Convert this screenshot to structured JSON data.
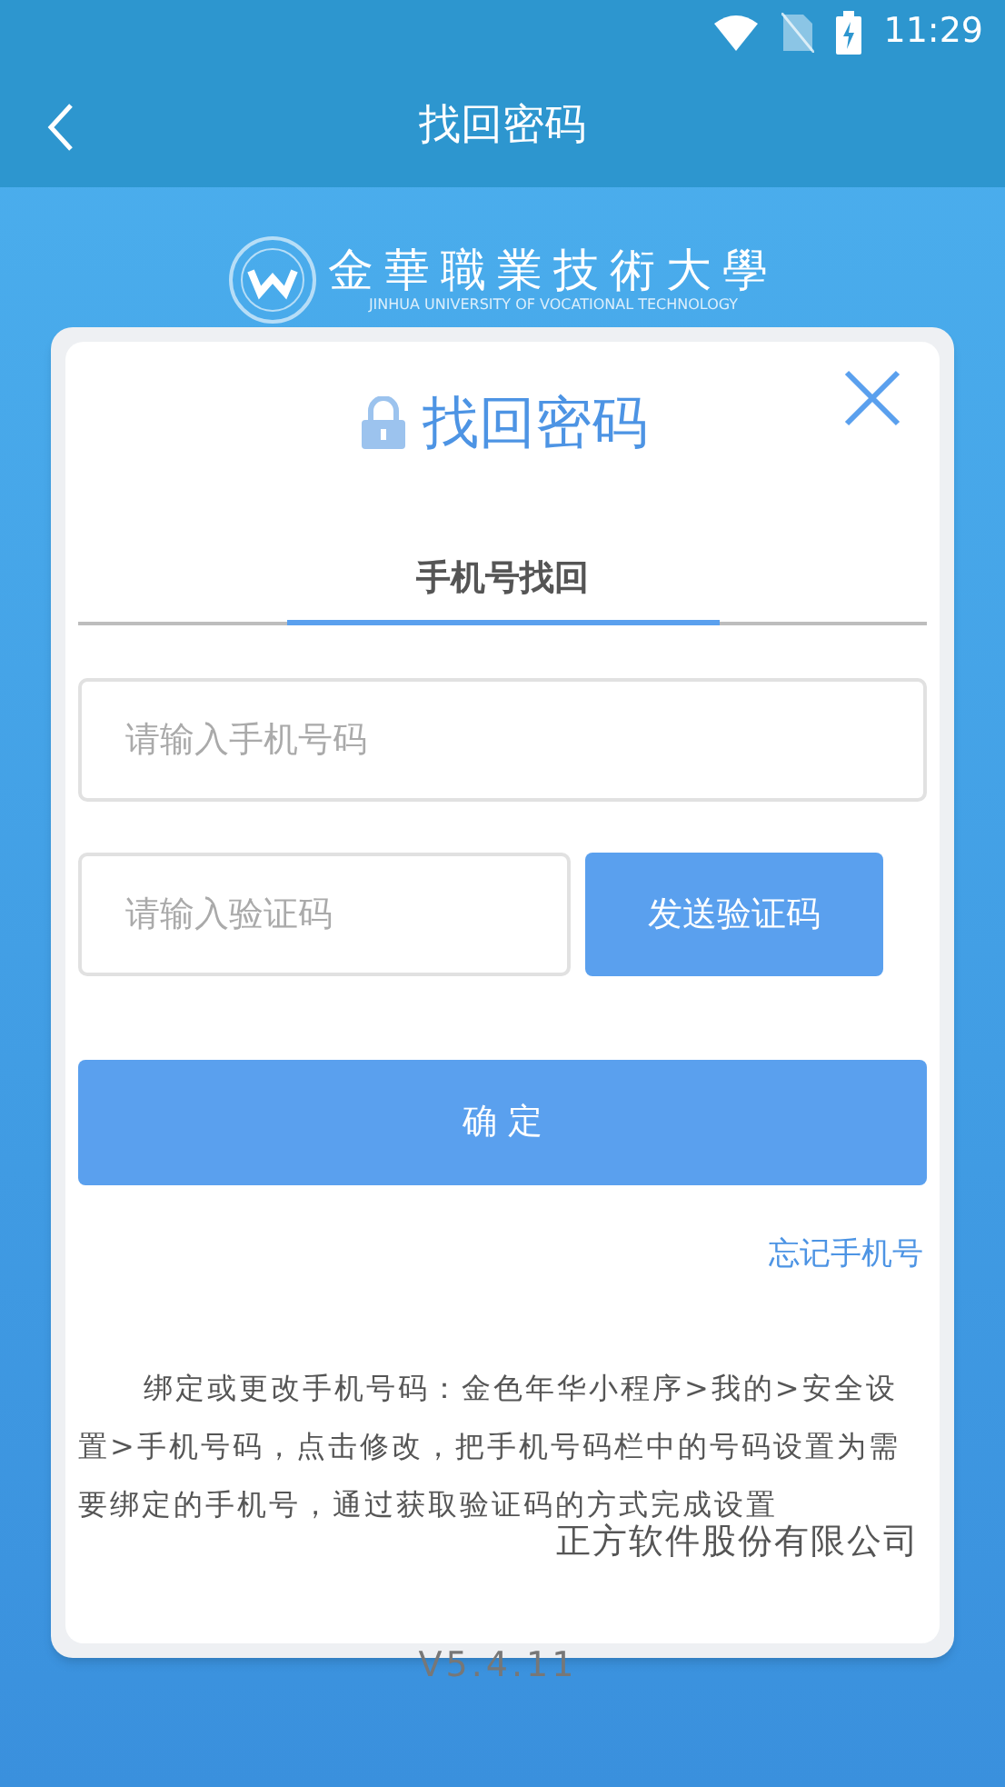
{
  "status_bar": {
    "time": "11:29"
  },
  "header": {
    "title": "找回密码"
  },
  "logo": {
    "name": "金華職業技術大學",
    "subtitle": "JINHUA UNIVERSITY OF VOCATIONAL TECHNOLOGY"
  },
  "card": {
    "title": "找回密码",
    "tabs": [
      {
        "label": "手机号找回",
        "selected": true
      }
    ],
    "phone_field": {
      "placeholder": "请输入手机号码"
    },
    "code_field": {
      "placeholder": "请输入验证码"
    },
    "send_code_button": "发送验证码",
    "confirm_button": "确 定",
    "forgot_link": "忘记手机号",
    "note": "绑定或更改手机号码：金色年华小程序>我的>安全设置>手机号码，点击修改，把手机号码栏中的号码设置为需要绑定的手机号，通过获取验证码的方式完成设置",
    "company": "正方软件股份有限公司"
  },
  "version": "V5.4.11"
}
